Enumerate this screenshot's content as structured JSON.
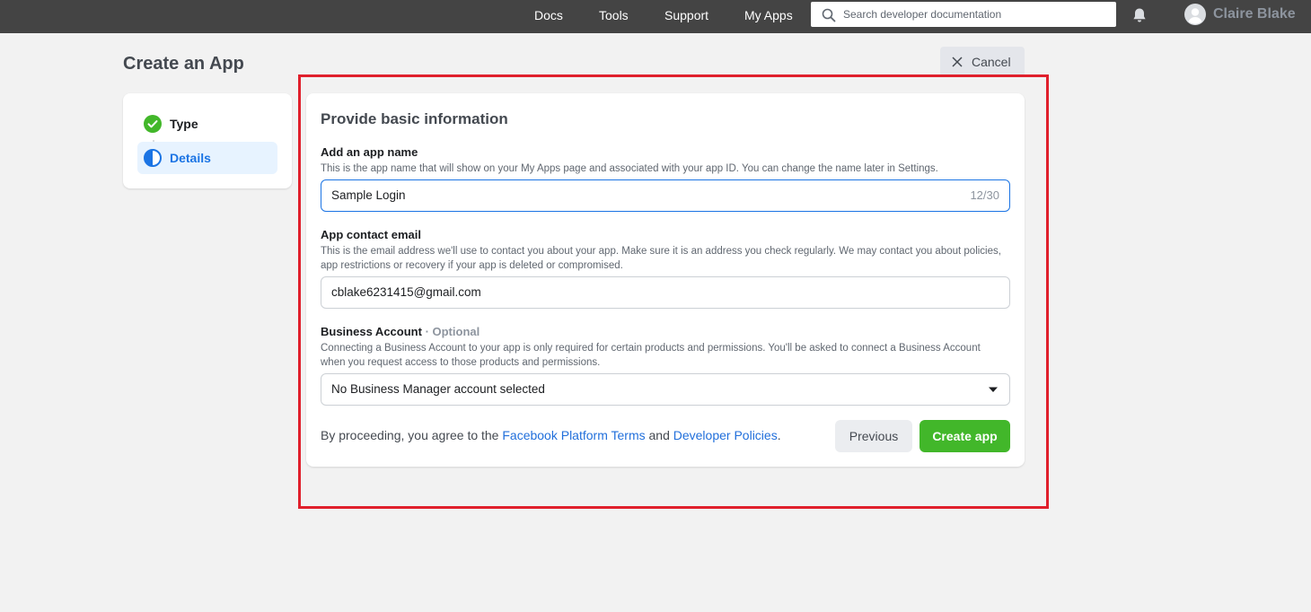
{
  "topbar": {
    "nav": [
      "Docs",
      "Tools",
      "Support",
      "My Apps"
    ],
    "search_placeholder": "Search developer documentation",
    "user_name": "Claire Blake",
    "icons": {
      "search": "search-icon",
      "notifications": "bell-icon",
      "avatar": "avatar-icon"
    }
  },
  "page": {
    "title": "Create an App",
    "cancel_label": "Cancel"
  },
  "steps": [
    {
      "label": "Type",
      "state": "complete",
      "icon": "check-circle-icon"
    },
    {
      "label": "Details",
      "state": "active",
      "icon": "half-circle-icon"
    }
  ],
  "form": {
    "heading": "Provide basic information",
    "app_name": {
      "label": "Add an app name",
      "help": "This is the app name that will show on your My Apps page and associated with your app ID. You can change the name later in Settings.",
      "value": "Sample Login",
      "counter": "12/30"
    },
    "contact_email": {
      "label": "App contact email",
      "help": "This is the email address we'll use to contact you about your app. Make sure it is an address you check regularly. We may contact you about policies, app restrictions or recovery if your app is deleted or compromised.",
      "value": "cblake6231415@gmail.com"
    },
    "business_account": {
      "label": "Business Account",
      "optional": "· Optional",
      "help": "Connecting a Business Account to your app is only required for certain products and permissions. You'll be asked to connect a Business Account when you request access to those products and permissions.",
      "selected": "No Business Manager account selected"
    },
    "terms": {
      "prefix": "By proceeding, you agree to the ",
      "platform_terms": "Facebook Platform Terms",
      "middle": " and ",
      "developer_policies": "Developer Policies",
      "suffix": "."
    },
    "previous_label": "Previous",
    "create_label": "Create app"
  },
  "colors": {
    "topbar": "#444444",
    "accent_blue": "#1b74e4",
    "link": "#216fdb",
    "create_green": "#42b72a",
    "highlight_red": "#e0202c"
  }
}
